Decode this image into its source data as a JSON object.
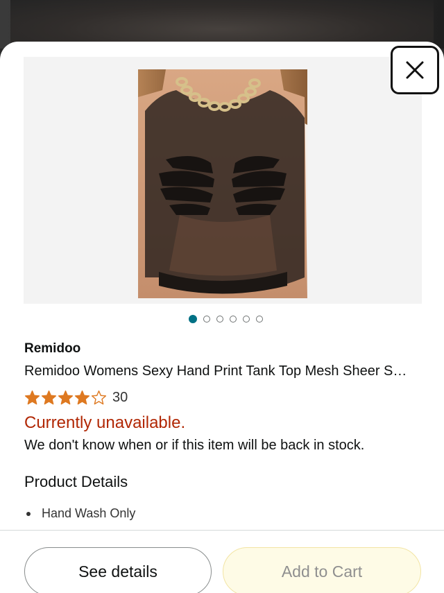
{
  "product": {
    "brand": "Remidoo",
    "title": "Remidoo Womens Sexy Hand Print Tank Top Mesh Sheer S…",
    "rating": 4,
    "rating_max": 5,
    "rating_count": "30",
    "availability": "Currently unavailable.",
    "stock_message": "We don't know when or if this item will be back in stock.",
    "image_count": 6,
    "active_image": 1
  },
  "details": {
    "heading": "Product Details",
    "bullets": [
      "Hand Wash Only"
    ]
  },
  "actions": {
    "see_details": "See details",
    "add_to_cart": "Add to Cart"
  },
  "colors": {
    "unavailable": "#b12704",
    "star": "#de7921",
    "active_dot": "#007185",
    "cart_bg": "#fefbe6"
  },
  "icons": {
    "close": "close-icon",
    "star": "star-icon"
  }
}
